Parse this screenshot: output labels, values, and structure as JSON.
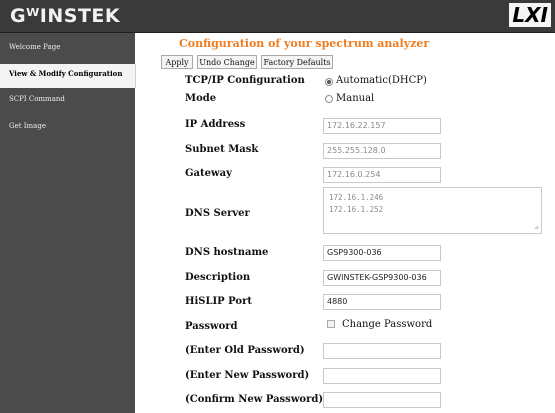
{
  "header": {
    "brand": "GᵂINSTEK",
    "lxi_logo": "LXI"
  },
  "sidebar": {
    "items": [
      {
        "label": "Welcome Page",
        "active": false
      },
      {
        "label": "View & Modify Configuration",
        "active": true
      },
      {
        "label": "SCPI Command",
        "active": false
      },
      {
        "label": "Get Image",
        "active": false
      }
    ]
  },
  "main": {
    "title": "Configuration of your spectrum analyzer",
    "buttons": {
      "apply": "Apply",
      "undo": "Undo Change",
      "factory": "Factory Defaults"
    },
    "tcpip": {
      "label": "TCP/IP Configuration",
      "mode_label": "Mode",
      "options": [
        {
          "label": "Automatic(DHCP)",
          "selected": true
        },
        {
          "label": "Manual",
          "selected": false
        }
      ]
    },
    "ip_address": {
      "label": "IP Address",
      "value": "172.16.22.157"
    },
    "subnet_mask": {
      "label": "Subnet Mask",
      "value": "255.255.128.0"
    },
    "gateway": {
      "label": "Gateway",
      "value": "172.16.0.254"
    },
    "dns_server": {
      "label": "DNS Server",
      "values": [
        "172.16.1.246",
        "172.16.1.252"
      ]
    },
    "dns_hostname": {
      "label": "DNS hostname",
      "value": "GSP9300-036"
    },
    "description": {
      "label": "Description",
      "value": "GWINSTEK-GSP9300-036"
    },
    "hislip_port": {
      "label": "HiSLIP Port",
      "value": "4880"
    },
    "password": {
      "label": "Password",
      "change_label": "Change Password",
      "checked": false
    },
    "old_password": {
      "label": "(Enter Old Password)",
      "value": ""
    },
    "new_password": {
      "label": "(Enter New Password)",
      "value": ""
    },
    "confirm_password": {
      "label": "(Confirm New Password)",
      "value": ""
    }
  },
  "colors": {
    "accent": "#ee7d22",
    "sidebar_bg": "#4b4b4b",
    "header_bg": "#3a3a3a"
  }
}
